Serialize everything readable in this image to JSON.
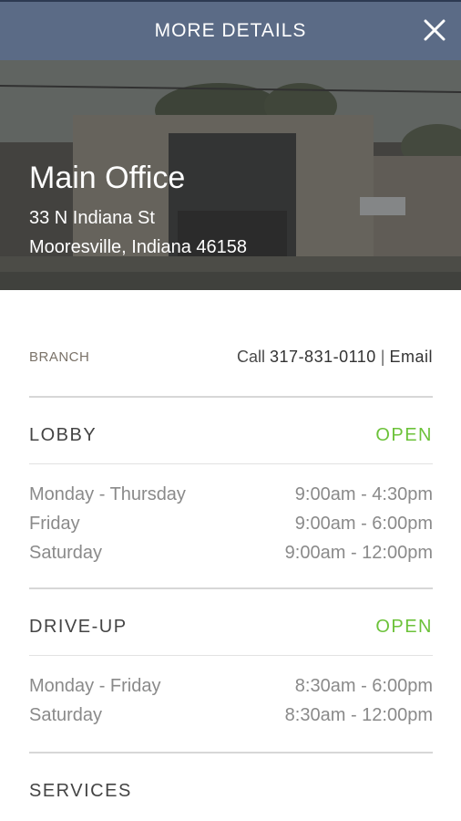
{
  "header": {
    "title": "MORE DETAILS"
  },
  "location": {
    "name": "Main Office",
    "address_line1": "33 N Indiana St",
    "address_line2": "Mooresville, Indiana 46158"
  },
  "branch": {
    "label": "BRANCH",
    "call_prefix": "Call ",
    "phone": "317-831-0110",
    "separator": " | ",
    "email_label": "Email"
  },
  "lobby": {
    "title": "LOBBY",
    "status": "OPEN",
    "hours": [
      {
        "days": "Monday - Thursday",
        "time": "9:00am - 4:30pm"
      },
      {
        "days": "Friday",
        "time": "9:00am - 6:00pm"
      },
      {
        "days": "Saturday",
        "time": "9:00am - 12:00pm"
      }
    ]
  },
  "drive_up": {
    "title": "DRIVE-UP",
    "status": "OPEN",
    "hours": [
      {
        "days": "Monday - Friday",
        "time": "8:30am - 6:00pm"
      },
      {
        "days": "Saturday",
        "time": "8:30am - 12:00pm"
      }
    ]
  },
  "services": {
    "title": "SERVICES"
  },
  "colors": {
    "header_bg": "#5b6b86",
    "open_status": "#6cc23a",
    "divider": "#d7d7d7"
  }
}
